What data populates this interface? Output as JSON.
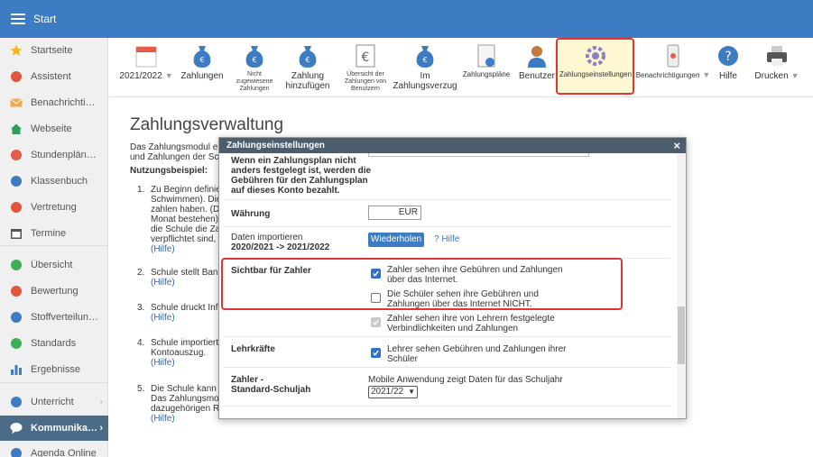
{
  "header": {
    "title": "Start",
    "menu_icon": "hamburger-icon"
  },
  "sidebar": {
    "items": [
      {
        "label": "Startseite",
        "icon": "star-icon",
        "color": "#f2b71d"
      },
      {
        "label": "Assistent",
        "icon": "wand-icon",
        "color": "#e0553c"
      },
      {
        "label": "Benachrichtigu...",
        "icon": "mail-icon",
        "color": "#f0a64a"
      },
      {
        "label": "Webseite",
        "icon": "home-icon",
        "color": "#2f9c5a"
      },
      {
        "label": "Stundenpläne ...",
        "icon": "timetable-icon",
        "color": "#e35d4a"
      },
      {
        "label": "Klassenbuch",
        "icon": "book-icon",
        "color": "#3d7cc3"
      },
      {
        "label": "Vertretung",
        "icon": "substitute-icon",
        "color": "#e0553c"
      },
      {
        "label": "Termine",
        "icon": "calendar-icon",
        "color": "#555555"
      },
      {
        "label": "Übersicht",
        "icon": "check-circle-icon",
        "color": "#3fae5a"
      },
      {
        "label": "Bewertung",
        "icon": "rating-icon",
        "color": "#e0553c"
      },
      {
        "label": "Stoffverteilung...",
        "icon": "list-icon",
        "color": "#3d7cc3"
      },
      {
        "label": "Standards",
        "icon": "shield-icon",
        "color": "#3fae5a"
      },
      {
        "label": "Ergebnisse",
        "icon": "bar-chart-icon",
        "color": "#3d7cc3"
      },
      {
        "label": "Unterricht",
        "icon": "lesson-icon",
        "color": "#3d7cc3"
      },
      {
        "label": "Kommunikation",
        "icon": "chat-icon",
        "color": "#ffffff"
      },
      {
        "label": "Agenda Online",
        "icon": "link-icon",
        "color": "#3d7cc3"
      }
    ]
  },
  "toolbar": {
    "items": [
      {
        "label": "2021/2022",
        "icon": "calendar-icon"
      },
      {
        "label": "Zahlungen",
        "icon": "money-bag-icon"
      },
      {
        "label": "Nicht zugewiesene Zahlungen",
        "lines": [
          "Nicht",
          "zugewiesene",
          "Zahlungen"
        ],
        "icon": "money-bag-question-icon"
      },
      {
        "label": "Zahlung hinzufügen",
        "lines": [
          "Zahlung",
          "hinzufügen"
        ],
        "icon": "money-bag-add-icon"
      },
      {
        "label": "Übersicht der Zahlungen von Benutzern",
        "lines": [
          "Übersicht der",
          "Zahlungen von",
          "Benutzern"
        ],
        "icon": "euro-document-icon"
      },
      {
        "label": "Im Zahlungsverzug",
        "lines": [
          "Im",
          "Zahlungsverzug"
        ],
        "icon": "money-bag-clock-icon"
      },
      {
        "label": "Zahlungspläne",
        "icon": "payment-plan-icon"
      },
      {
        "label": "Benutzer",
        "icon": "user-icon"
      },
      {
        "label": "Zahlungseinstellungen",
        "icon": "gear-icon"
      },
      {
        "label": "Benachrichtigungen",
        "icon": "phone-notification-icon"
      },
      {
        "label": "Hilfe",
        "icon": "help-icon"
      },
      {
        "label": "Drucken",
        "icon": "printer-icon"
      }
    ]
  },
  "main": {
    "title": "Zahlungsverwaltung",
    "intro_lines": [
      "Das Zahlungsmodul e",
      "und Zahlungen der Sch"
    ],
    "example_heading": "Nutzungsbeispiel:",
    "steps": [
      {
        "num": "1.",
        "lines": [
          "Zu Beginn definie",
          "Schwimmen). Die",
          "zahlen haben. (Di",
          "Monat bestehen).",
          "die Schule die Za",
          "verpflichtet sind, c"
        ],
        "hilfe": "(Hilfe)"
      },
      {
        "num": "2.",
        "lines": [
          "Schule stellt Bank"
        ],
        "hilfe": "(Hilfe)"
      },
      {
        "num": "3.",
        "lines": [
          "Schule druckt Info"
        ],
        "hilfe": "(Hilfe)"
      },
      {
        "num": "4.",
        "lines": [
          "Schule importiert",
          "Kontoauszug."
        ],
        "hilfe": "(Hilfe)"
      },
      {
        "num": "5.",
        "lines": [
          "Die Schule kann a",
          "Das Zahlungsmod",
          "dazugehörigen Re"
        ],
        "hilfe": "(Hilfe)"
      }
    ]
  },
  "dialog": {
    "title": "Zahlungseinstellungen",
    "close": "×",
    "plan_note_lines": [
      "Wenn ein Zahlungsplan nicht",
      "anders festgelegt ist, werden die",
      "Gebühren für den Zahlungsplan",
      "auf dieses Konto bezahlt."
    ],
    "currency_label": "Währung",
    "currency_value": "EUR",
    "import_label_lines": [
      "Daten importieren",
      "2020/2021 -> 2021/2022"
    ],
    "restore_button": "Wiederholen",
    "help_link": "? Hilfe",
    "visible_label": "Sichtbar für Zahler",
    "option_payer_lines": [
      "Zahler sehen ihre Gebühren und Zahlungen",
      "über das Internet."
    ],
    "option_students_lines": [
      "Die Schüler sehen ihre Gebühren und",
      "Zahlungen über das Internet NICHT."
    ],
    "option_teacher_lines": [
      "Zahler sehen ihre von Lehrern festgelegte",
      "Verbindlichkeiten und Zahlungen"
    ],
    "teachers_label": "Lehrkräfte",
    "option_teachers_lines": [
      "Lehrer sehen Gebühren und Zahlungen ihrer",
      "Schüler"
    ],
    "year_label_lines": [
      "Zahler -",
      "Standard-Schuljah"
    ],
    "mobile_text": "Mobile Anwendung zeigt Daten für das Schuljahr",
    "year_select": "2021/22",
    "checked": {
      "payer": true,
      "students": false,
      "teacher_set": true,
      "teachers": true
    }
  }
}
